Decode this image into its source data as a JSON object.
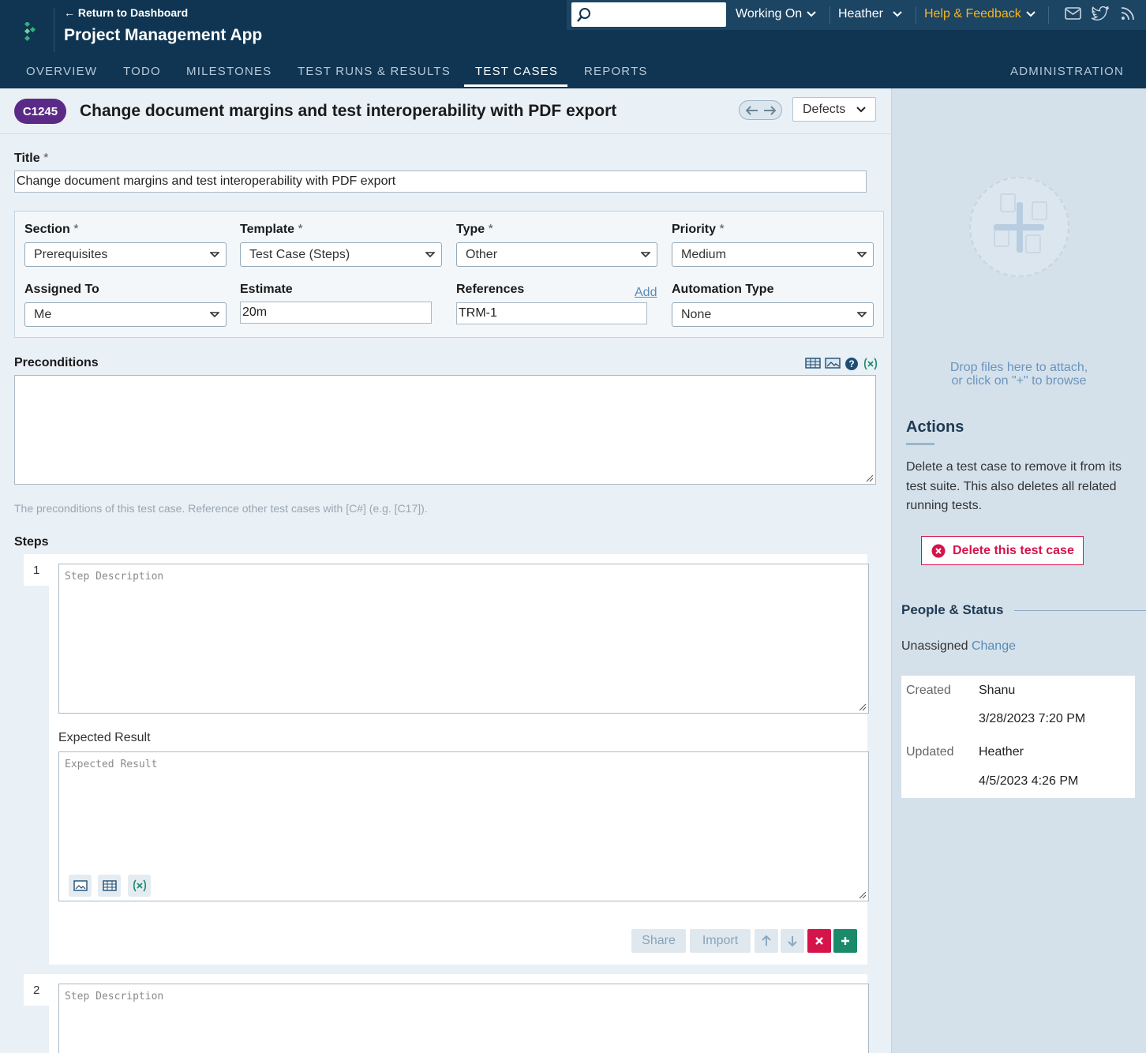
{
  "header": {
    "return_link": "← Return to Dashboard",
    "app_title": "Project Management App",
    "search": {
      "value": ""
    },
    "working_on": "Working On",
    "user": "Heather",
    "help": "Help & Feedback"
  },
  "nav": {
    "overview": "OVERVIEW",
    "todo": "TODO",
    "milestones": "MILESTONES",
    "test_runs": "TEST RUNS & RESULTS",
    "test_cases": "TEST CASES",
    "reports": "REPORTS",
    "administration": "ADMINISTRATION",
    "active": "TEST CASES"
  },
  "case": {
    "id": "C1245",
    "title": "Change document margins and test interoperability with PDF export",
    "defects_label": "Defects"
  },
  "form": {
    "title_label": "Title",
    "title_value": "Change document margins and test interoperability with PDF export",
    "required_mark": "*",
    "section_label": "Section",
    "section_value": "Prerequisites",
    "template_label": "Template",
    "template_value": "Test Case (Steps)",
    "type_label": "Type",
    "type_value": "Other",
    "priority_label": "Priority",
    "priority_value": "Medium",
    "assigned_label": "Assigned To",
    "assigned_value": "Me",
    "estimate_label": "Estimate",
    "estimate_value": "20m",
    "references_label": "References",
    "references_add": "Add",
    "references_value": "TRM-1",
    "automation_label": "Automation Type",
    "automation_value": "None",
    "preconditions_label": "Preconditions",
    "preconditions_help": "The preconditions of this test case. Reference other test cases with [C#] (e.g. [C17]).",
    "steps_label": "Steps"
  },
  "steps": [
    {
      "number": "1",
      "description_placeholder": "Step Description",
      "expected_label": "Expected Result",
      "expected_placeholder": "Expected Result"
    },
    {
      "number": "2",
      "description_placeholder": "Step Description"
    }
  ],
  "step_buttons": {
    "share": "Share",
    "import": "Import"
  },
  "sidebar": {
    "drop_text_1": "Drop files here to attach,",
    "drop_text_2": "or click on \"+\" to browse",
    "actions_title": "Actions",
    "actions_desc": "Delete a test case to remove it from its test suite. This also deletes all related running tests.",
    "delete_label": "Delete this test case",
    "people_title": "People & Status",
    "assignment": "Unassigned",
    "change_link": "Change",
    "created_label": "Created",
    "created_by": "Shanu",
    "created_at": "3/28/2023 7:20 PM",
    "updated_label": "Updated",
    "updated_by": "Heather",
    "updated_at": "4/5/2023 4:26 PM"
  },
  "colors": {
    "header_bg": "#0f3552",
    "badge": "#5b2a86",
    "help_accent": "#f3b623",
    "delete": "#d4144a",
    "add_step": "#1a8a6a"
  }
}
